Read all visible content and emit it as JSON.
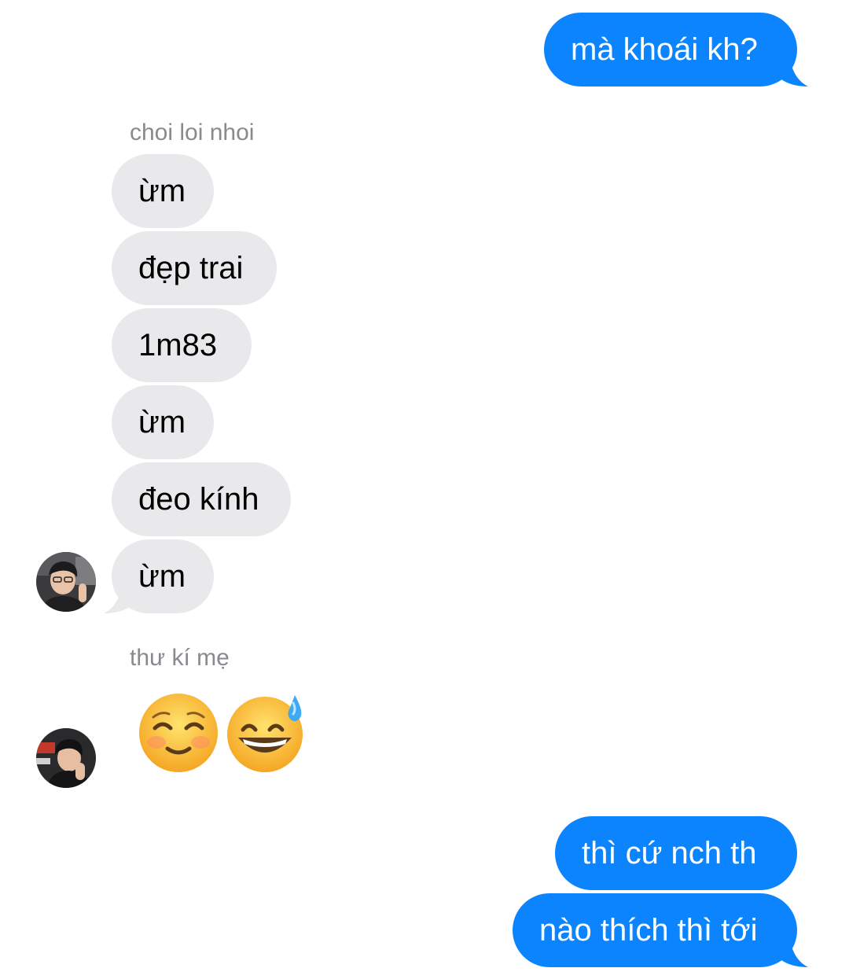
{
  "conversation": {
    "messages": [
      {
        "id": "m1",
        "direction": "outgoing",
        "text": "mà khoái kh?"
      },
      {
        "id": "g1_label",
        "sender": "choi loi nhoi"
      },
      {
        "id": "m2",
        "direction": "incoming",
        "text": "ừm"
      },
      {
        "id": "m3",
        "direction": "incoming",
        "text": "đẹp trai"
      },
      {
        "id": "m4",
        "direction": "incoming",
        "text": "1m83"
      },
      {
        "id": "m5",
        "direction": "incoming",
        "text": "ừm"
      },
      {
        "id": "m6",
        "direction": "incoming",
        "text": "đeo kính"
      },
      {
        "id": "m7",
        "direction": "incoming",
        "text": "ừm"
      },
      {
        "id": "g2_label",
        "sender": "thư kí mẹ"
      },
      {
        "id": "m8",
        "direction": "incoming",
        "emoji": [
          "smiling-face-icon",
          "grinning-sweat-icon"
        ]
      },
      {
        "id": "m9",
        "direction": "outgoing",
        "text": "thì cứ nch th"
      },
      {
        "id": "m10",
        "direction": "outgoing",
        "text": "nào thích thì tới"
      }
    ],
    "senders": {
      "first": "choi loi nhoi",
      "second": "thư kí mẹ"
    },
    "colors": {
      "outgoing_bubble": "#0b84fe",
      "incoming_bubble": "#e9e9eb",
      "sender_label": "#8a8a8e"
    }
  }
}
